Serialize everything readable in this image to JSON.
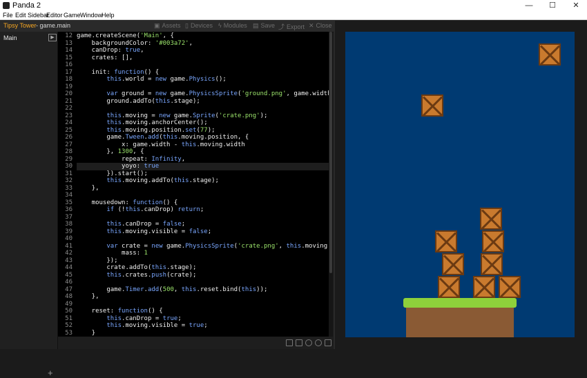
{
  "window": {
    "title": "Panda 2",
    "minimize_icon": "—",
    "maximize_icon": "☐",
    "close_icon": "✕"
  },
  "menu": [
    "File",
    "Edit",
    "Sidebar",
    "Editor",
    "Game",
    "Window",
    "Help"
  ],
  "project": {
    "name": "Tipsy Tower",
    "file": "- game.main"
  },
  "toolbar": [
    {
      "label": "Assets",
      "icon": "▣"
    },
    {
      "label": "Devices",
      "icon": "▯"
    },
    {
      "label": "Modules",
      "icon": "ϟ"
    },
    {
      "label": "Save",
      "icon": "▤"
    },
    {
      "label": "Export",
      "icon": "⤴"
    },
    {
      "label": "Close",
      "icon": "✕"
    }
  ],
  "sidebar": {
    "item": "Main",
    "play_icon": "▶",
    "add_icon": "+"
  },
  "editor": {
    "active_line": 30,
    "lines": [
      {
        "n": 12,
        "t": [
          [
            "game.createScene(",
            ""
          ],
          [
            "'Main'",
            "str"
          ],
          [
            ", {",
            ""
          ]
        ]
      },
      {
        "n": 13,
        "t": [
          [
            "    backgroundColor: ",
            ""
          ],
          [
            "'#003a72'",
            "str"
          ],
          [
            ",",
            ""
          ]
        ]
      },
      {
        "n": 14,
        "t": [
          [
            "    canDrop: ",
            ""
          ],
          [
            "true",
            "kw"
          ],
          [
            ",",
            ""
          ]
        ]
      },
      {
        "n": 15,
        "t": [
          [
            "    crates: [],",
            ""
          ]
        ]
      },
      {
        "n": 16,
        "t": [
          [
            "",
            ""
          ]
        ]
      },
      {
        "n": 17,
        "t": [
          [
            "    init: ",
            ""
          ],
          [
            "function",
            "kw"
          ],
          [
            "() {",
            ""
          ]
        ]
      },
      {
        "n": 18,
        "t": [
          [
            "        ",
            ""
          ],
          [
            "this",
            "kw"
          ],
          [
            ".world = ",
            ""
          ],
          [
            "new",
            "kw"
          ],
          [
            " game.",
            ""
          ],
          [
            "Physics",
            "kw"
          ],
          [
            "();",
            ""
          ]
        ]
      },
      {
        "n": 19,
        "t": [
          [
            "",
            ""
          ]
        ]
      },
      {
        "n": 20,
        "t": [
          [
            "        ",
            ""
          ],
          [
            "var",
            "kw"
          ],
          [
            " ground = ",
            ""
          ],
          [
            "new",
            "kw"
          ],
          [
            " game.",
            ""
          ],
          [
            "PhysicsSprite",
            "kw"
          ],
          [
            "(",
            ""
          ],
          [
            "'ground.png'",
            "str"
          ],
          [
            ", game.width",
            ""
          ]
        ]
      },
      {
        "n": 21,
        "t": [
          [
            "        ground.addTo(",
            ""
          ],
          [
            "this",
            "kw"
          ],
          [
            ".stage);",
            ""
          ]
        ]
      },
      {
        "n": 22,
        "t": [
          [
            "",
            ""
          ]
        ]
      },
      {
        "n": 23,
        "t": [
          [
            "        ",
            ""
          ],
          [
            "this",
            "kw"
          ],
          [
            ".moving = ",
            ""
          ],
          [
            "new",
            "kw"
          ],
          [
            " game.",
            ""
          ],
          [
            "Sprite",
            "kw"
          ],
          [
            "(",
            ""
          ],
          [
            "'crate.png'",
            "str"
          ],
          [
            ");",
            ""
          ]
        ]
      },
      {
        "n": 24,
        "t": [
          [
            "        ",
            ""
          ],
          [
            "this",
            "kw"
          ],
          [
            ".moving.anchorCenter();",
            ""
          ]
        ]
      },
      {
        "n": 25,
        "t": [
          [
            "        ",
            ""
          ],
          [
            "this",
            "kw"
          ],
          [
            ".moving.position.",
            ""
          ],
          [
            "set",
            "kw"
          ],
          [
            "(",
            ""
          ],
          [
            "77",
            "str"
          ],
          [
            ");",
            ""
          ]
        ]
      },
      {
        "n": 26,
        "t": [
          [
            "        game.",
            ""
          ],
          [
            "Tween",
            "kw"
          ],
          [
            ".",
            ""
          ],
          [
            "add",
            "kw"
          ],
          [
            "(",
            ""
          ],
          [
            "this",
            "kw"
          ],
          [
            ".moving.position, {",
            ""
          ]
        ]
      },
      {
        "n": 27,
        "t": [
          [
            "            x: game.width - ",
            ""
          ],
          [
            "this",
            "kw"
          ],
          [
            ".moving.width",
            ""
          ]
        ]
      },
      {
        "n": 28,
        "t": [
          [
            "        }, ",
            ""
          ],
          [
            "1300",
            "str"
          ],
          [
            ", {",
            ""
          ]
        ]
      },
      {
        "n": 29,
        "t": [
          [
            "            repeat: ",
            ""
          ],
          [
            "Infinity",
            "kw"
          ],
          [
            ",",
            ""
          ]
        ]
      },
      {
        "n": 30,
        "t": [
          [
            "            yoyo: ",
            ""
          ],
          [
            "true",
            "kw"
          ]
        ]
      },
      {
        "n": 31,
        "t": [
          [
            "        }).start();",
            ""
          ]
        ]
      },
      {
        "n": 32,
        "t": [
          [
            "        ",
            ""
          ],
          [
            "this",
            "kw"
          ],
          [
            ".moving.addTo(",
            ""
          ],
          [
            "this",
            "kw"
          ],
          [
            ".stage);",
            ""
          ]
        ]
      },
      {
        "n": 33,
        "t": [
          [
            "    },",
            ""
          ]
        ]
      },
      {
        "n": 34,
        "t": [
          [
            "",
            ""
          ]
        ]
      },
      {
        "n": 35,
        "t": [
          [
            "    mousedown: ",
            ""
          ],
          [
            "function",
            "kw"
          ],
          [
            "() {",
            ""
          ]
        ]
      },
      {
        "n": 36,
        "t": [
          [
            "        ",
            ""
          ],
          [
            "if",
            "kw"
          ],
          [
            " (!",
            ""
          ],
          [
            "this",
            "kw"
          ],
          [
            ".canDrop) ",
            ""
          ],
          [
            "return",
            "kw"
          ],
          [
            ";",
            ""
          ]
        ]
      },
      {
        "n": 37,
        "t": [
          [
            "",
            ""
          ]
        ]
      },
      {
        "n": 38,
        "t": [
          [
            "        ",
            ""
          ],
          [
            "this",
            "kw"
          ],
          [
            ".canDrop = ",
            ""
          ],
          [
            "false",
            "kw"
          ],
          [
            ";",
            ""
          ]
        ]
      },
      {
        "n": 39,
        "t": [
          [
            "        ",
            ""
          ],
          [
            "this",
            "kw"
          ],
          [
            ".moving.visible = ",
            ""
          ],
          [
            "false",
            "kw"
          ],
          [
            ";",
            ""
          ]
        ]
      },
      {
        "n": 40,
        "t": [
          [
            "",
            ""
          ]
        ]
      },
      {
        "n": 41,
        "t": [
          [
            "        ",
            ""
          ],
          [
            "var",
            "kw"
          ],
          [
            " crate = ",
            ""
          ],
          [
            "new",
            "kw"
          ],
          [
            " game.",
            ""
          ],
          [
            "PhysicsSprite",
            "kw"
          ],
          [
            "(",
            ""
          ],
          [
            "'crate.png'",
            "str"
          ],
          [
            ", ",
            ""
          ],
          [
            "this",
            "kw"
          ],
          [
            ".moving.x",
            ""
          ]
        ]
      },
      {
        "n": 42,
        "t": [
          [
            "            mass: ",
            ""
          ],
          [
            "1",
            "str"
          ]
        ]
      },
      {
        "n": 43,
        "t": [
          [
            "        });",
            ""
          ]
        ]
      },
      {
        "n": 44,
        "t": [
          [
            "        crate.addTo(",
            ""
          ],
          [
            "this",
            "kw"
          ],
          [
            ".stage);",
            ""
          ]
        ]
      },
      {
        "n": 45,
        "t": [
          [
            "        ",
            ""
          ],
          [
            "this",
            "kw"
          ],
          [
            ".crates.",
            ""
          ],
          [
            "push",
            "kw"
          ],
          [
            "(crate);",
            ""
          ]
        ]
      },
      {
        "n": 46,
        "t": [
          [
            "",
            ""
          ]
        ]
      },
      {
        "n": 47,
        "t": [
          [
            "        game.",
            ""
          ],
          [
            "Timer",
            "kw"
          ],
          [
            ".",
            ""
          ],
          [
            "add",
            "kw"
          ],
          [
            "(",
            ""
          ],
          [
            "500",
            "str"
          ],
          [
            ", ",
            ""
          ],
          [
            "this",
            "kw"
          ],
          [
            ".reset.bind(",
            ""
          ],
          [
            "this",
            "kw"
          ],
          [
            "));",
            ""
          ]
        ]
      },
      {
        "n": 48,
        "t": [
          [
            "    },",
            ""
          ]
        ]
      },
      {
        "n": 49,
        "t": [
          [
            "",
            ""
          ]
        ]
      },
      {
        "n": 50,
        "t": [
          [
            "    reset: ",
            ""
          ],
          [
            "function",
            "kw"
          ],
          [
            "() {",
            ""
          ]
        ]
      },
      {
        "n": 51,
        "t": [
          [
            "        ",
            ""
          ],
          [
            "this",
            "kw"
          ],
          [
            ".canDrop = ",
            ""
          ],
          [
            "true",
            "kw"
          ],
          [
            ";",
            ""
          ]
        ]
      },
      {
        "n": 52,
        "t": [
          [
            "        ",
            ""
          ],
          [
            "this",
            "kw"
          ],
          [
            ".moving.visible = ",
            ""
          ],
          [
            "true",
            "kw"
          ],
          [
            ";",
            ""
          ]
        ]
      },
      {
        "n": 53,
        "t": [
          [
            "    }",
            ""
          ]
        ]
      }
    ]
  },
  "colors": {
    "canvas_bg": "#003a72",
    "accent": "#f5a623",
    "keyword": "#7aa7ff",
    "string": "#9be36b"
  },
  "game": {
    "crate_icon": "crate-icon",
    "ground_icon": "ground-icon"
  }
}
